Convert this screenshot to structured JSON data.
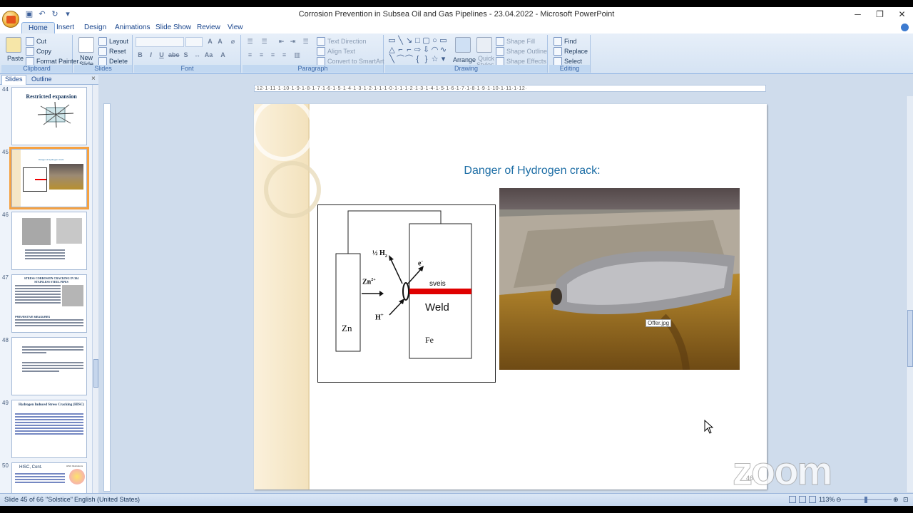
{
  "window": {
    "title": "Corrosion Prevention in Subsea Oil and Gas Pipelines - 23.04.2022 - Microsoft PowerPoint"
  },
  "tabs": [
    "Home",
    "Insert",
    "Design",
    "Animations",
    "Slide Show",
    "Review",
    "View"
  ],
  "ribbon": {
    "clipboard": {
      "paste": "Paste",
      "cut": "Cut",
      "copy": "Copy",
      "format_painter": "Format Painter",
      "label": "Clipboard"
    },
    "slides": {
      "new_slide": "New",
      "new_slide2": "Slide",
      "layout": "Layout",
      "reset": "Reset",
      "delete": "Delete",
      "label": "Slides"
    },
    "font": {
      "label": "Font"
    },
    "paragraph": {
      "text_direction": "Text Direction",
      "align_text": "Align Text",
      "convert_smartart": "Convert to SmartArt",
      "label": "Paragraph"
    },
    "drawing": {
      "arrange": "Arrange",
      "quick_styles": "Quick",
      "quick_styles2": "Styles",
      "shape_fill": "Shape Fill",
      "shape_outline": "Shape Outline",
      "shape_effects": "Shape Effects",
      "label": "Drawing"
    },
    "editing": {
      "find": "Find",
      "replace": "Replace",
      "select": "Select",
      "label": "Editing"
    }
  },
  "panel": {
    "tab_slides": "Slides",
    "tab_outline": "Outline",
    "close": "×"
  },
  "thumbnails": [
    {
      "num": "44",
      "title": "Restricted expansion"
    },
    {
      "num": "45",
      "title": "Danger of Hydrogen crack:"
    },
    {
      "num": "46",
      "title": ""
    },
    {
      "num": "47",
      "title": "STRESS CORROSION CRACKING IN 304 STAINLESS STEEL PIPES",
      "subtitle": "PREVENTIVE MEASURES"
    },
    {
      "num": "48",
      "title": ""
    },
    {
      "num": "49",
      "title": "Hydrogen Induced Stress Cracking (HISC)"
    },
    {
      "num": "50",
      "title": "HISC, Cont.",
      "badge": "HISC Illustrations"
    }
  ],
  "ruler_text": "·12·1·11·1·10·1·9·1·8·1·7·1·6·1·5·1·4·1·3·1·2·1·1·1·0·1·1·1·2·1·3·1·4·1·5·1·6·1·7·1·8·1·9·1·10·1·11·1·12·",
  "slide": {
    "title": "Danger of Hydrogen crack:",
    "diagram": {
      "h2": "½ H",
      "h2_sub": "2",
      "e": "e",
      "e_sup": "-",
      "zn_ion": "Zn",
      "zn_ion_sup": "2+",
      "h_plus": "H",
      "h_plus_sup": "+",
      "sveis": "sveis",
      "weld": "Weld",
      "zn": "Zn",
      "fe": "Fe"
    },
    "photo_tooltip": "Offer.jpg",
    "page_number": "46"
  },
  "status": {
    "slide": "Slide 45 of 66",
    "theme": "\"Solstice\"",
    "language": "English (United States)",
    "zoom": "113%"
  },
  "overlay": {
    "zoom_watermark": "zoom"
  }
}
